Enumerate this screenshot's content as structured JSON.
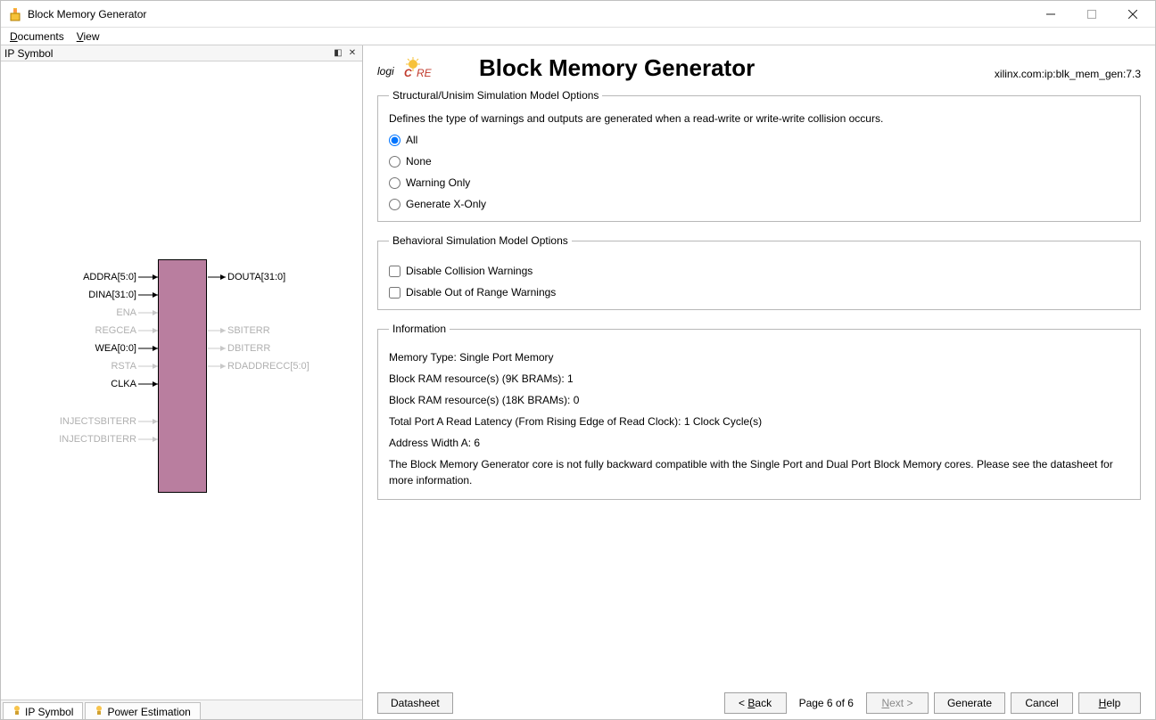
{
  "window": {
    "title": "Block Memory Generator"
  },
  "menu": {
    "documents": "Documents",
    "view": "View"
  },
  "leftPane": {
    "header": "IP Symbol",
    "tabs": {
      "ipSymbol": "IP Symbol",
      "powerEstimation": "Power Estimation"
    },
    "ports": {
      "left": [
        "ADDRA[5:0]",
        "DINA[31:0]",
        "ENA",
        "REGCEA",
        "WEA[0:0]",
        "RSTA",
        "CLKA"
      ],
      "leftLower": [
        "INJECTSBITERR",
        "INJECTDBITERR"
      ],
      "right": [
        "DOUTA[31:0]",
        "SBITERR",
        "DBITERR",
        "RDADDRECC[5:0]"
      ]
    }
  },
  "rightPane": {
    "logoText": "logiCORE",
    "title": "Block Memory Generator",
    "ipId": "xilinx.com:ip:blk_mem_gen:7.3",
    "group1": {
      "legend": "Structural/Unisim Simulation Model Options",
      "desc": "Defines the type of warnings and outputs are generated when a read-write or write-write collision occurs.",
      "options": [
        "All",
        "None",
        "Warning Only",
        "Generate X-Only"
      ]
    },
    "group2": {
      "legend": "Behavioral Simulation Model Options",
      "opt1": "Disable Collision Warnings",
      "opt2": "Disable Out of Range Warnings"
    },
    "group3": {
      "legend": "Information",
      "lines": [
        "Memory Type: Single Port Memory",
        "Block RAM resource(s) (9K BRAMs): 1",
        "Block RAM resource(s) (18K BRAMs): 0",
        "Total Port A Read Latency (From Rising Edge of Read Clock): 1 Clock Cycle(s)",
        "Address Width A: 6",
        "The Block Memory Generator core is not fully backward compatible with the Single Port and Dual Port Block Memory cores. Please see the datasheet for more information."
      ]
    },
    "footer": {
      "datasheet": "Datasheet",
      "back": "< Back",
      "page": "Page 6 of 6",
      "next": "Next >",
      "generate": "Generate",
      "cancel": "Cancel",
      "help": "Help"
    }
  }
}
